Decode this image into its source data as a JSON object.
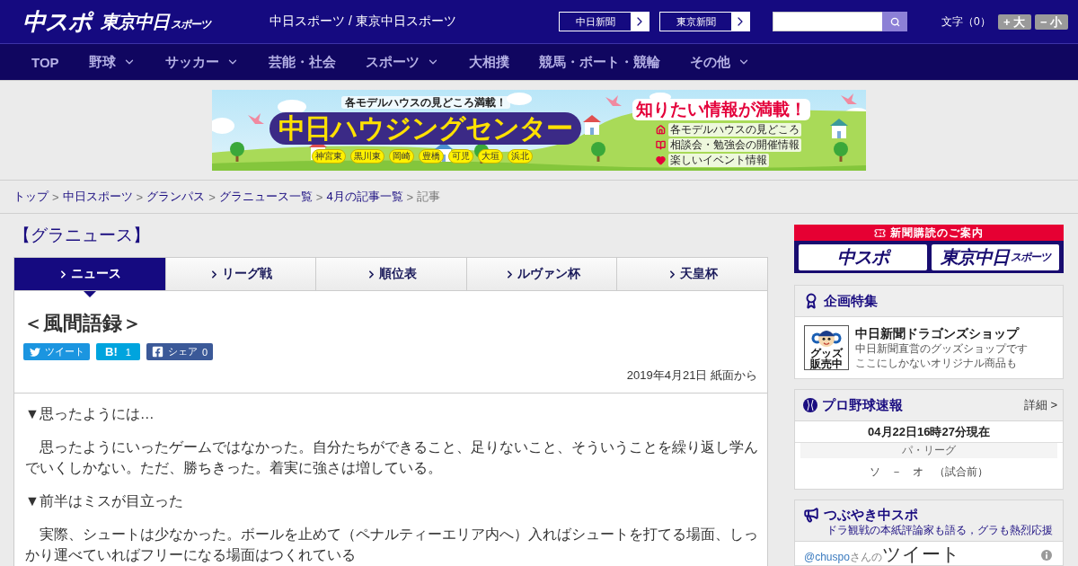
{
  "header": {
    "logos": [
      {
        "text": "中スポ"
      },
      {
        "text": "東京中日",
        "small": "スポーツ"
      }
    ],
    "site_names": "中日スポーツ / 東京中日スポーツ",
    "paper_links": [
      "中日新聞",
      "東京新聞"
    ],
    "text_size": {
      "label": "文字（0）",
      "buttons": [
        "+ 大",
        "− 小"
      ]
    }
  },
  "nav": [
    {
      "label": "TOP",
      "dropdown": false
    },
    {
      "label": "野球",
      "dropdown": true
    },
    {
      "label": "サッカー",
      "dropdown": true
    },
    {
      "label": "芸能・社会",
      "dropdown": false
    },
    {
      "label": "スポーツ",
      "dropdown": true
    },
    {
      "label": "大相撲",
      "dropdown": false
    },
    {
      "label": "競馬・ボート・競輪",
      "dropdown": false
    },
    {
      "label": "その他",
      "dropdown": true
    }
  ],
  "banner": {
    "tagline": "各モデルハウスの見どころ満載！",
    "title": "中日ハウジングセンター",
    "locations": [
      "神宮東",
      "黒川東",
      "岡崎",
      "豊橋",
      "可児",
      "大垣",
      "浜北"
    ],
    "headline": "知りたい情報が満載！",
    "features": [
      {
        "kind": "house",
        "label": "各モデルハウスの見どころ"
      },
      {
        "kind": "book",
        "label": "相談会・勉強会の開催情報"
      },
      {
        "kind": "heart",
        "label": "楽しいイベント情報"
      }
    ]
  },
  "breadcrumb": [
    {
      "kind": "link",
      "label": "トップ"
    },
    {
      "kind": "separator",
      "label": ">"
    },
    {
      "kind": "link",
      "label": "中日スポーツ"
    },
    {
      "kind": "separator",
      "label": ">"
    },
    {
      "kind": "link",
      "label": "グランパス"
    },
    {
      "kind": "separator",
      "label": ">"
    },
    {
      "kind": "link",
      "label": "グラニュース一覧"
    },
    {
      "kind": "separator",
      "label": ">"
    },
    {
      "kind": "link",
      "label": "4月の記事一覧"
    },
    {
      "kind": "separator",
      "label": ">"
    },
    {
      "kind": "current",
      "label": "記事"
    }
  ],
  "section_title": "【グラニュース】",
  "tabs": [
    {
      "label": "ニュース",
      "selected": true
    },
    {
      "label": "リーグ戦",
      "selected": false
    },
    {
      "label": "順位表",
      "selected": false
    },
    {
      "label": "ルヴァン杯",
      "selected": false
    },
    {
      "label": "天皇杯",
      "selected": false
    }
  ],
  "article": {
    "title": "＜風間語録＞",
    "share": [
      {
        "kind": "twitter",
        "label": "ツイート"
      },
      {
        "kind": "hatena",
        "label": "B!",
        "count": "1"
      },
      {
        "kind": "facebook",
        "label": "シェア",
        "count": "0"
      }
    ],
    "date": "2019年4月21日 紙面から",
    "body": [
      "▼思ったようには…",
      "　思ったようにいったゲームではなかった。自分たちができること、足りないこと、そういうことを繰り返し学んでいくしかない。ただ、勝ちきった。着実に強さは増している。",
      "▼前半はミスが目立った",
      "　実際、シュートは少なかった。ボールを止めて（ペナルティーエリア内へ）入ればシュートを打てる場面、しっかり運べていればフリーになる場面はつくれている"
    ]
  },
  "sidebar": {
    "subscription": {
      "title": "新聞購読のご案内",
      "logos": [
        {
          "text": "中スポ"
        },
        {
          "text": "東京中日",
          "small": "スポーツ"
        }
      ]
    },
    "feature": {
      "title": "企画特集",
      "item": {
        "thumbnail_caption": "グッズ販売中",
        "title": "中日新聞ドラゴンズショップ",
        "description": [
          "中日新聞直営のグッズショップです",
          "ここにしかないオリジナル商品も"
        ]
      }
    },
    "baseball": {
      "title": "プロ野球速報",
      "more": "詳細 >",
      "updated": "04月22日16時27分現在",
      "leagues": [
        {
          "name": "パ・リーグ",
          "games": [
            {
              "home": "ソ",
              "score": "－",
              "away": "オ",
              "status": "（試合前）"
            }
          ]
        }
      ]
    },
    "tweets": {
      "title": "つぶやき中スポ",
      "subtitle": "ドラ観戦の本紙評論家も語る，グラも熱烈応援",
      "account": "@chuspo",
      "title_prefix": "さんの",
      "timeline_title": "ツイート"
    }
  }
}
